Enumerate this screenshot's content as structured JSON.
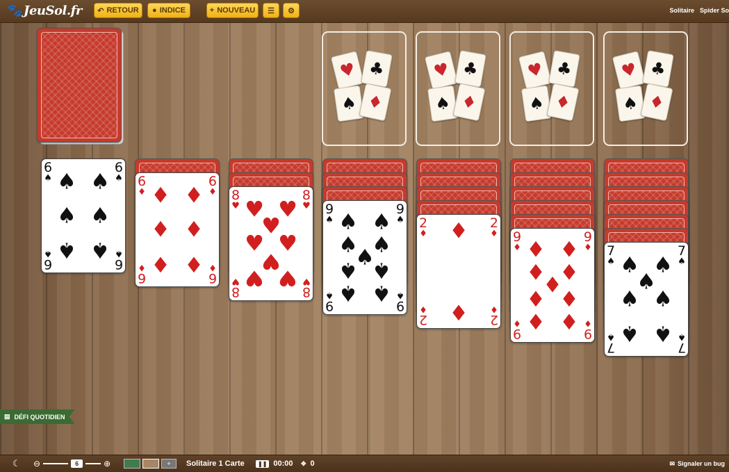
{
  "header": {
    "logo": "JeuSol.fr",
    "logo_icon": "paw-icon",
    "buttons": {
      "retour": "RETOUR",
      "indice": "INDICE",
      "nouveau": "NOUVEAU"
    },
    "links": [
      "Solitaire",
      "Spider So"
    ]
  },
  "colors": {
    "accent_button": "#f0b114",
    "card_back": "#c63a2c",
    "red_suit": "#d11f1f",
    "challenge_ribbon": "#3b6b32"
  },
  "foundation_suits": [
    "♥",
    "♣",
    "♠",
    "♦"
  ],
  "tableau": [
    {
      "rank": "6",
      "suit": "♠",
      "color": "black",
      "hidden": 0
    },
    {
      "rank": "6",
      "suit": "♦",
      "color": "red",
      "hidden": 1
    },
    {
      "rank": "8",
      "suit": "♥",
      "color": "red",
      "hidden": 2
    },
    {
      "rank": "9",
      "suit": "♠",
      "color": "black",
      "hidden": 3
    },
    {
      "rank": "2",
      "suit": "♦",
      "color": "red",
      "hidden": 4
    },
    {
      "rank": "9",
      "suit": "♦",
      "color": "red",
      "hidden": 5
    },
    {
      "rank": "7",
      "suit": "♠",
      "color": "black",
      "hidden": 6
    }
  ],
  "daily_challenge": "DÉFI QUOTIDIEN",
  "footer": {
    "zoom_value": "6",
    "add_label": "+",
    "game_name": "Solitaire 1 Carte",
    "timer": "00:00",
    "moves": "0",
    "bug_report": "Signaler un bug"
  }
}
